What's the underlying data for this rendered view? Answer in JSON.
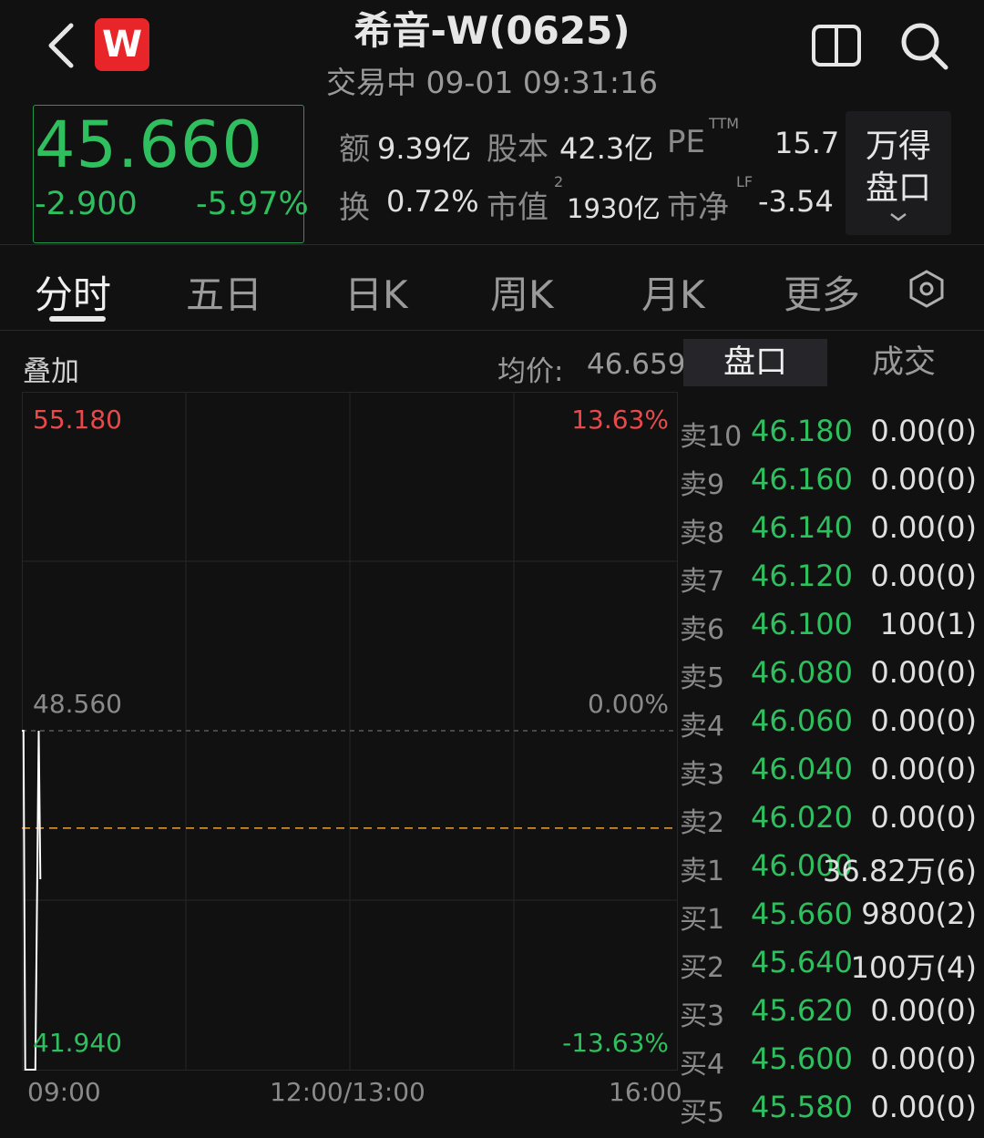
{
  "header": {
    "logo_text": "W",
    "title": "希音-W(0625)",
    "status": "交易中 09-01 09:31:16"
  },
  "quote": {
    "price": "45.660",
    "change": "-2.900",
    "change_pct": "-5.97%"
  },
  "stats": {
    "amount_label": "额",
    "amount_value": "9.39亿",
    "share_label": "股本",
    "share_value": "42.3亿",
    "pe_label": "PE",
    "pe_sup": "TTM",
    "pe_value": "15.7",
    "turnover_label": "换",
    "turnover_value": "0.72%",
    "mcap_label": "市值",
    "mcap_sup": "2",
    "mcap_value": "1930亿",
    "pb_label": "市净",
    "pb_sup": "LF",
    "pb_value": "-3.54",
    "wande_line1": "万得",
    "wande_line2": "盘口"
  },
  "tabs": [
    "分时",
    "五日",
    "日K",
    "周K",
    "月K",
    "更多"
  ],
  "chart_header": {
    "overlay": "叠加",
    "avg_label": "均价:",
    "avg_value": "46.659"
  },
  "side_tabs": [
    "盘口",
    "成交"
  ],
  "chart_data": {
    "type": "line",
    "y_max_label": "55.180",
    "y_max_pct": "13.63%",
    "y_mid_label": "48.560",
    "y_mid_pct": "0.00%",
    "y_min_label": "41.940",
    "y_min_pct": "-13.63%",
    "ylim": [
      41.94,
      55.18
    ],
    "prev_close": 48.56,
    "avg_price": 46.659,
    "x_labels": [
      "09:00",
      "12:00/13:00",
      "16:00"
    ],
    "x_range_minutes": [
      0,
      390
    ],
    "price_series": [
      {
        "t": 0,
        "v": 48.56
      },
      {
        "t": 1,
        "v": 48.56
      },
      {
        "t": 2,
        "v": 41.94
      },
      {
        "t": 8,
        "v": 41.94
      },
      {
        "t": 10,
        "v": 48.56
      },
      {
        "t": 11,
        "v": 45.66
      }
    ],
    "colors": {
      "line": "#ffffff",
      "avg": "#e8a23a",
      "up": "#e84a4a",
      "down": "#2fbf5f"
    }
  },
  "order_book": [
    {
      "label": "卖10",
      "price": "46.180",
      "vol": "0.00(0)"
    },
    {
      "label": "卖9",
      "price": "46.160",
      "vol": "0.00(0)"
    },
    {
      "label": "卖8",
      "price": "46.140",
      "vol": "0.00(0)"
    },
    {
      "label": "卖7",
      "price": "46.120",
      "vol": "0.00(0)"
    },
    {
      "label": "卖6",
      "price": "46.100",
      "vol": "100(1)"
    },
    {
      "label": "卖5",
      "price": "46.080",
      "vol": "0.00(0)"
    },
    {
      "label": "卖4",
      "price": "46.060",
      "vol": "0.00(0)"
    },
    {
      "label": "卖3",
      "price": "46.040",
      "vol": "0.00(0)"
    },
    {
      "label": "卖2",
      "price": "46.020",
      "vol": "0.00(0)"
    },
    {
      "label": "卖1",
      "price": "46.000",
      "vol": "36.82万(6)"
    },
    {
      "label": "买1",
      "price": "45.660",
      "vol": "9800(2)"
    },
    {
      "label": "买2",
      "price": "45.640",
      "vol": "100万(4)"
    },
    {
      "label": "买3",
      "price": "45.620",
      "vol": "0.00(0)"
    },
    {
      "label": "买4",
      "price": "45.600",
      "vol": "0.00(0)"
    },
    {
      "label": "买5",
      "price": "45.580",
      "vol": "0.00(0)"
    }
  ],
  "icons": {
    "back": "chevron-left-icon",
    "split": "split-view-icon",
    "search": "search-icon",
    "settings": "settings-hexagon-icon",
    "expand": "chevron-down-icon"
  }
}
